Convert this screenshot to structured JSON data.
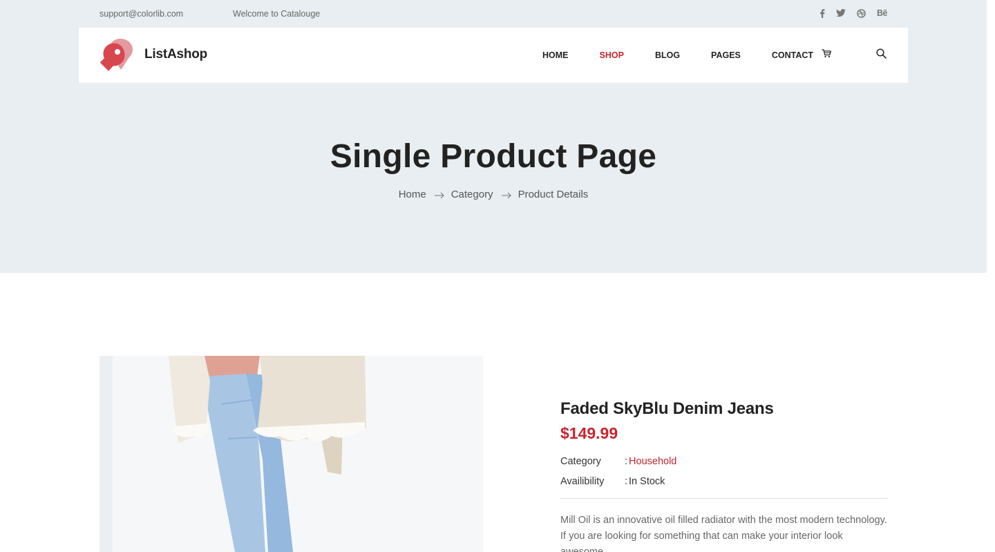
{
  "topbar": {
    "email": "support@colorlib.com",
    "welcome": "Welcome to Catalouge",
    "social": [
      {
        "icon": "facebook-icon",
        "glyph": "f"
      },
      {
        "icon": "twitter-icon"
      },
      {
        "icon": "dribbble-icon"
      },
      {
        "icon": "behance-icon",
        "glyph": "Bē"
      }
    ]
  },
  "header": {
    "brand": "ListAshop",
    "nav": [
      "HOME",
      "SHOP",
      "BLOG",
      "PAGES",
      "CONTACT"
    ],
    "active_nav": "SHOP",
    "icons": [
      "cart-icon",
      "search-icon"
    ]
  },
  "hero": {
    "title": "Single Product Page",
    "breadcrumb": [
      "Home",
      "Category",
      "Product Details"
    ]
  },
  "product": {
    "name": "Faded SkyBlu Denim Jeans",
    "price": "$149.99",
    "meta": [
      {
        "label": "Category",
        "value": "Household"
      },
      {
        "label": "Availibility",
        "value": "In Stock"
      }
    ],
    "description": "Mill Oil is an innovative oil filled radiator with the most modern technology. If you are looking for something that can make your interior look awesome,"
  },
  "colors": {
    "accent": "#c7252f",
    "hero_bg": "#e8eef1",
    "text": "#222222",
    "muted": "#666666"
  }
}
